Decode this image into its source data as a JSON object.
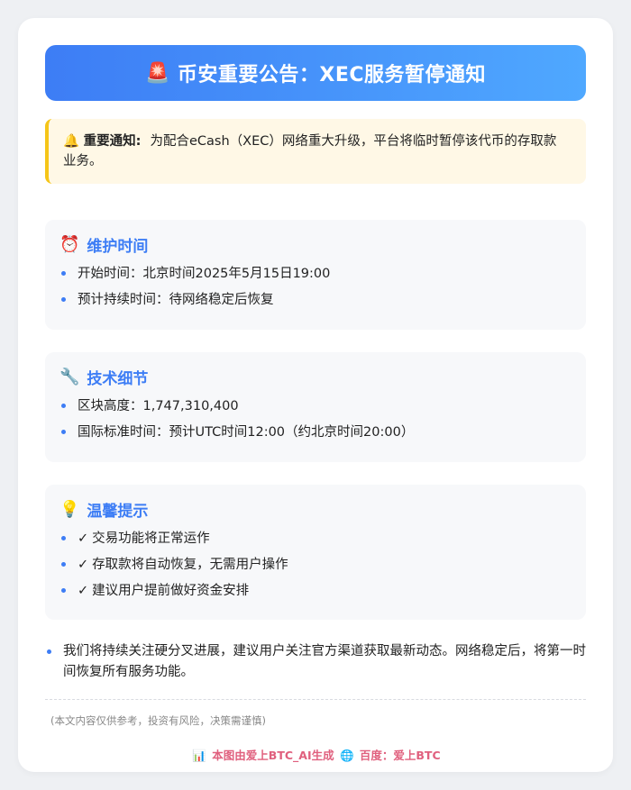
{
  "header": {
    "icon": "alarm-light-icon",
    "title": "币安重要公告：XEC服务暂停通知"
  },
  "notice": {
    "icon": "bell-icon",
    "label": "重要通知:",
    "text": "为配合eCash（XEC）网络重大升级，平台将临时暂停该代币的存取款业务。"
  },
  "sections": {
    "maintenance": {
      "icon": "alarm-clock-icon",
      "title": "维护时间",
      "items": [
        "开始时间：北京时间2025年5月15日19:00",
        "预计持续时间：待网络稳定后恢复"
      ]
    },
    "tech": {
      "icon": "wrench-icon",
      "title": "技术细节",
      "items": [
        "区块高度：1,747,310,400",
        "国际标准时间：预计UTC时间12:00（约北京时间20:00）"
      ]
    },
    "tips": {
      "icon": "lightbulb-icon",
      "title": "温馨提示",
      "check": "✓",
      "items": [
        "交易功能将正常运作",
        "存取款将自动恢复，无需用户操作",
        "建议用户提前做好资金安排"
      ]
    }
  },
  "closing": "我们将持续关注硬分叉进展，建议用户关注官方渠道获取最新动态。网络稳定后，将第一时间恢复所有服务功能。",
  "disclaimer": "(本文内容仅供参考，投资有风险，决策需谨慎)",
  "footer": {
    "chart_icon": "bar-chart-icon",
    "left": "本图由爱上BTC_AI生成",
    "globe_icon": "globe-icon",
    "right": "百度：爱上BTC"
  },
  "colors": {
    "accent": "#3d7df5",
    "notice_border": "#f5c518",
    "footer_pink": "#e0607e"
  }
}
